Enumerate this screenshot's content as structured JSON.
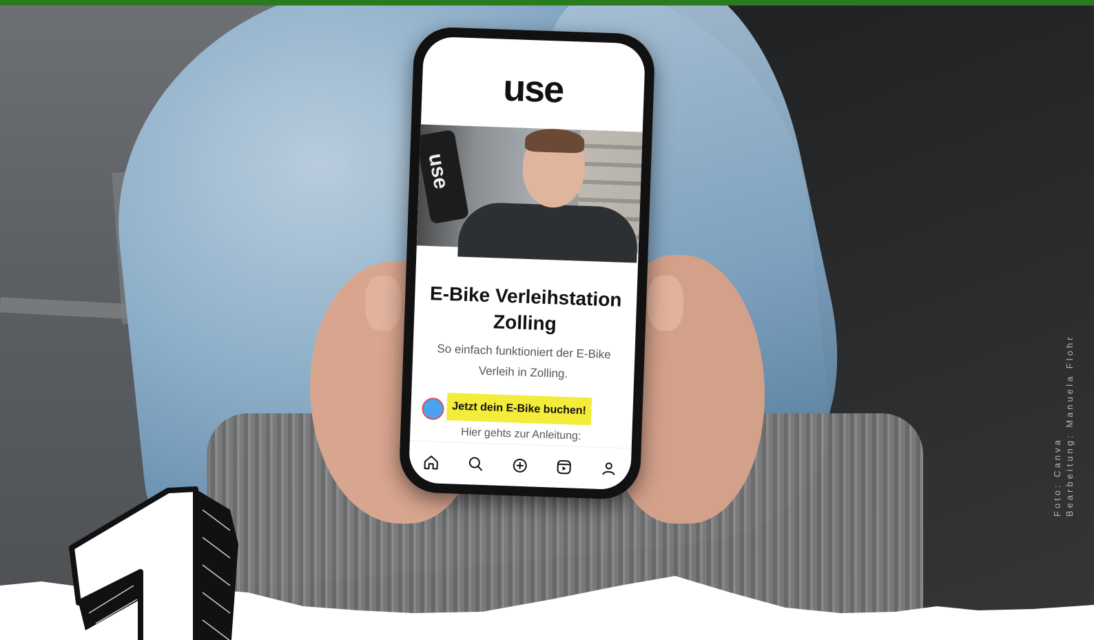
{
  "phone": {
    "app_logo": "use",
    "title_line1": "E-Bike Verleihstation",
    "title_line2": "Zolling",
    "subtitle_line1": "So einfach funktioniert der E-Bike",
    "subtitle_line2": "Verleih in Zolling.",
    "cta_label": "Jetzt dein E-Bike buchen!",
    "anleitung_text": "Hier gehts zur Anleitung:",
    "nav_icons": [
      "home-icon",
      "search-icon",
      "add-icon",
      "reels-icon",
      "profile-icon"
    ]
  },
  "overlay": {
    "number": "1",
    "credit_line1": "Foto: Canva",
    "credit_line2": "Bearbeitung: Manuela Flohr"
  },
  "colors": {
    "top_bar": "#2a7a1f",
    "cta_background": "#f3ec3a",
    "torn_paper": "#ffffff"
  }
}
